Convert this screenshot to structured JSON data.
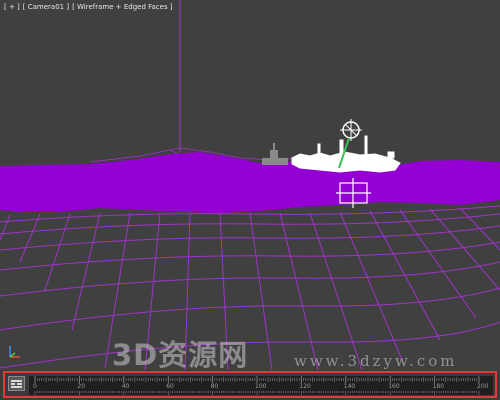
{
  "viewport": {
    "label_parts": [
      "[ + ]",
      "[ Camera01 ]",
      "[ Wireframe + Edged Faces ]"
    ],
    "colors": {
      "background": "#404040",
      "wire": "#a033cc",
      "terrain_fill": "#9400d3",
      "ship": "#ffffff",
      "camera_helper": "#37c25a"
    }
  },
  "watermark": {
    "cn": "3D资源网",
    "url": "www.3dzyw.com"
  },
  "axis_gizmo": {
    "icon": "xyz-axis-icon"
  },
  "timeline": {
    "toggle_icon": "timeline-toggle-icon",
    "ruler_labels": [
      "0",
      "20",
      "40",
      "60",
      "80",
      "100",
      "120",
      "140",
      "160",
      "180",
      "200"
    ],
    "highlight_color": "#e23a3a"
  }
}
